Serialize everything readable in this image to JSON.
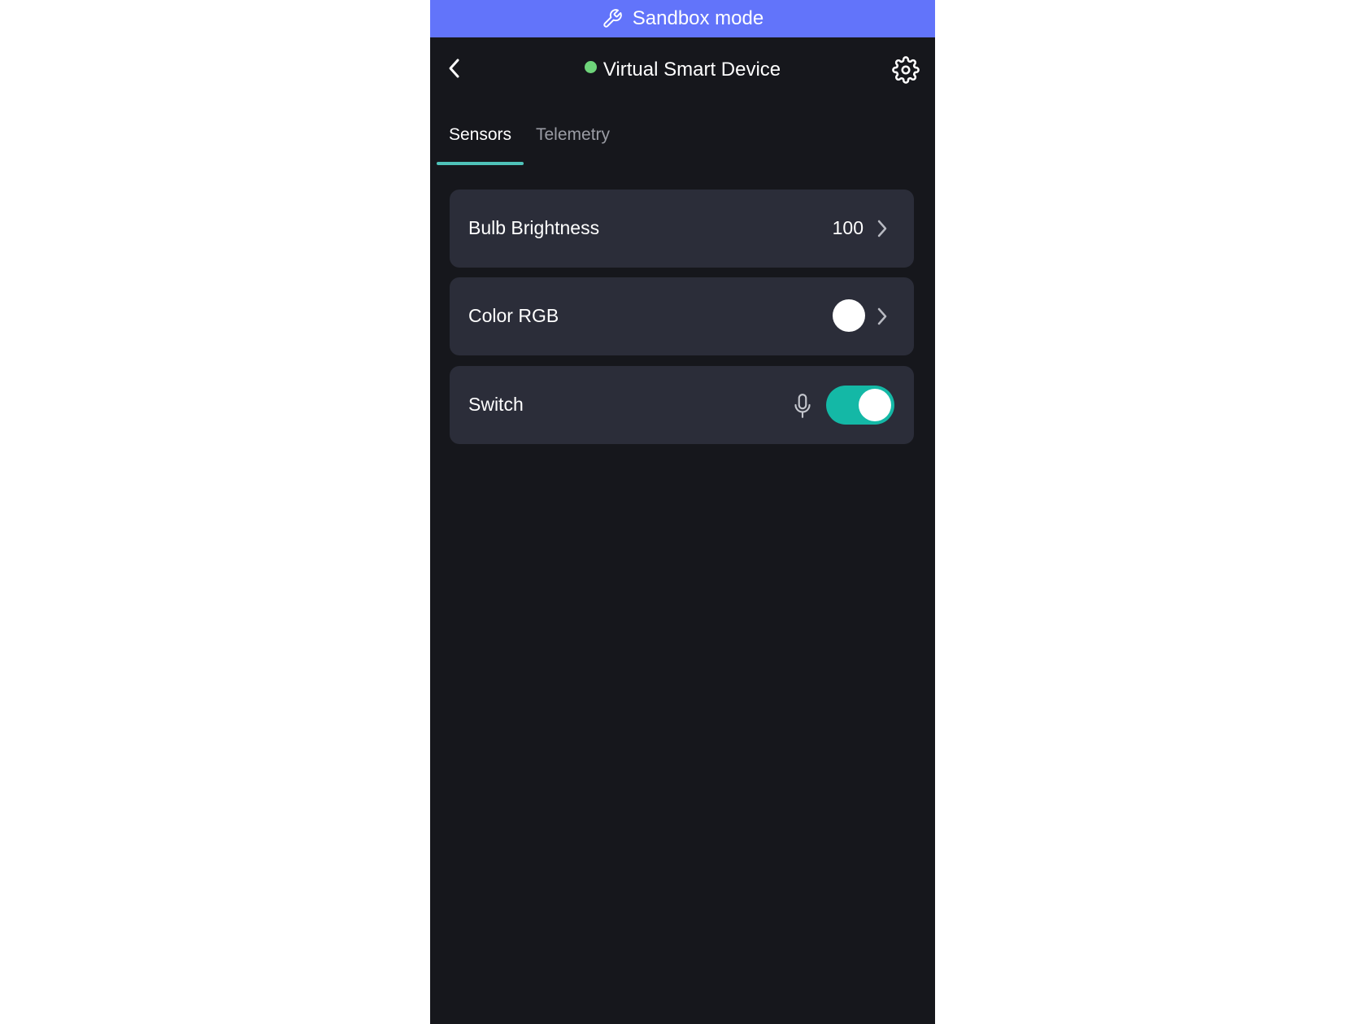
{
  "banner": {
    "icon": "wrench-icon",
    "label": "Sandbox mode",
    "color": "#6274fa"
  },
  "header": {
    "back_icon": "chevron-left-icon",
    "title": "Virtual Smart Device",
    "status_color": "#6ed47a",
    "settings_icon": "gear-icon"
  },
  "tabs": [
    {
      "label": "Sensors",
      "active": true
    },
    {
      "label": "Telemetry",
      "active": false
    }
  ],
  "sensors": [
    {
      "label": "Bulb Brightness",
      "value": "100",
      "icon": "chevron-right-icon"
    },
    {
      "label": "Color RGB",
      "swatch_color": "#ffffff",
      "icon": "chevron-right-icon"
    },
    {
      "label": "Switch",
      "mic_icon": "microphone-icon",
      "toggle_on": true,
      "toggle_color": "#14b8a6"
    }
  ]
}
